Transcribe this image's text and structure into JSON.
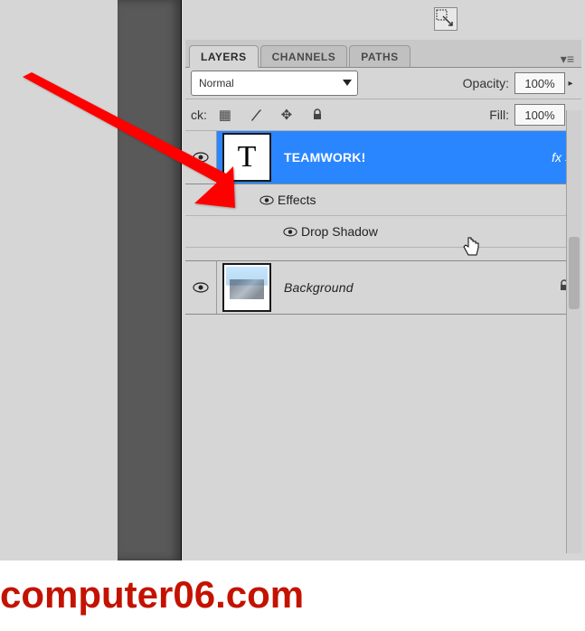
{
  "tabs": {
    "layers": "LAYERS",
    "channels": "CHANNELS",
    "paths": "PATHS"
  },
  "blend": {
    "mode": "Normal"
  },
  "opacity": {
    "label": "Opacity:",
    "value": "100%"
  },
  "fill": {
    "label": "Fill:",
    "value": "100%"
  },
  "lock": {
    "label": "ck:"
  },
  "layers": {
    "text_layer": {
      "name": "TEAMWORK!",
      "fx": "fx",
      "effects_label": "Effects",
      "drop_shadow_label": "Drop Shadow"
    },
    "background": {
      "name": "Background"
    }
  },
  "watermark": "computer06.com"
}
